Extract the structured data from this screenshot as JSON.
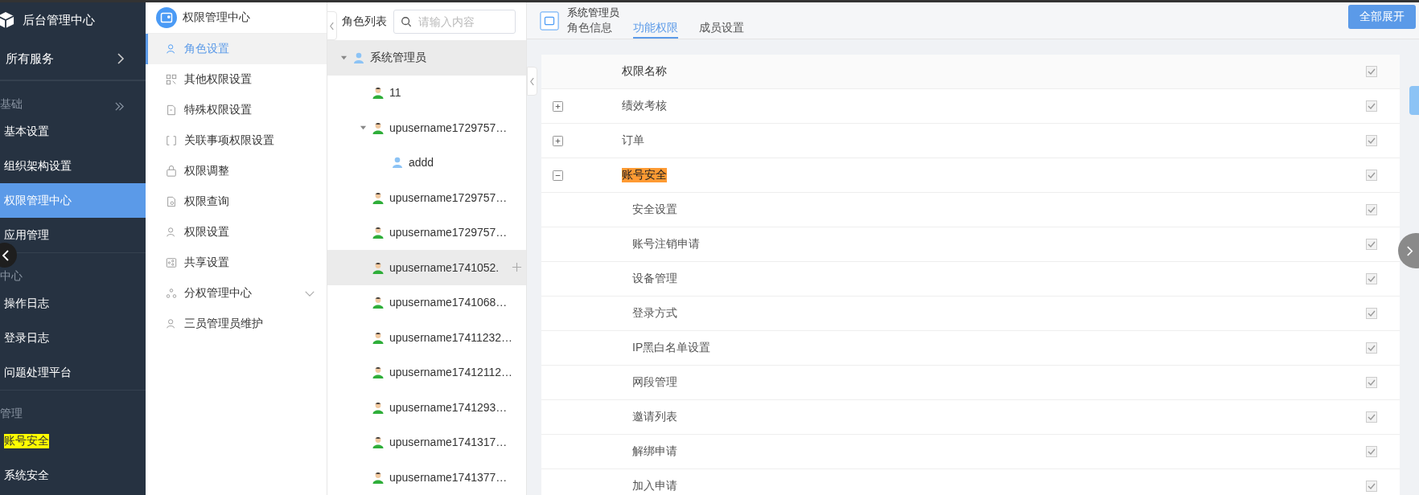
{
  "app": {
    "title": "后台管理中心"
  },
  "left_nav": [
    {
      "kind": "service",
      "label": "所有服务"
    },
    {
      "kind": "section",
      "label": "基础"
    },
    {
      "kind": "item",
      "label": "基本设置",
      "selected": false,
      "highlighted": false
    },
    {
      "kind": "item",
      "label": "组织架构设置",
      "selected": false,
      "highlighted": false
    },
    {
      "kind": "item",
      "label": "权限管理中心",
      "selected": true,
      "highlighted": false
    },
    {
      "kind": "item",
      "label": "应用管理",
      "selected": false,
      "highlighted": false
    },
    {
      "kind": "section",
      "label": "中心"
    },
    {
      "kind": "item",
      "label": "操作日志",
      "selected": false,
      "highlighted": false
    },
    {
      "kind": "item",
      "label": "登录日志",
      "selected": false,
      "highlighted": false
    },
    {
      "kind": "item",
      "label": "问题处理平台",
      "selected": false,
      "highlighted": false
    },
    {
      "kind": "section",
      "label": "管理"
    },
    {
      "kind": "item",
      "label": "账号安全",
      "selected": false,
      "highlighted": true
    },
    {
      "kind": "item",
      "label": "系统安全",
      "selected": false,
      "highlighted": false
    }
  ],
  "sub_nav": {
    "title": "权限管理中心",
    "items": [
      {
        "label": "角色设置",
        "selected": true,
        "expandable": false
      },
      {
        "label": "其他权限设置",
        "selected": false,
        "expandable": false
      },
      {
        "label": "特殊权限设置",
        "selected": false,
        "expandable": false
      },
      {
        "label": "关联事项权限设置",
        "selected": false,
        "expandable": false
      },
      {
        "label": "权限调整",
        "selected": false,
        "expandable": false
      },
      {
        "label": "权限查询",
        "selected": false,
        "expandable": false
      },
      {
        "label": "权限设置",
        "selected": false,
        "expandable": false
      },
      {
        "label": "共享设置",
        "selected": false,
        "expandable": false
      },
      {
        "label": "分权管理中心",
        "selected": false,
        "expandable": true
      },
      {
        "label": "三员管理员维护",
        "selected": false,
        "expandable": false
      }
    ]
  },
  "role_list": {
    "title": "角色列表",
    "search_placeholder": "请输入内容",
    "nodes": [
      {
        "kind": "role",
        "label": "系统管理员",
        "expanded": true,
        "selected": true,
        "hovered": false,
        "children": [
          {
            "kind": "user",
            "label": "11",
            "selected": false,
            "hovered": false
          },
          {
            "kind": "user",
            "label": "upusername1729757…",
            "expanded": true,
            "selected": false,
            "hovered": false,
            "children": [
              {
                "kind": "role",
                "label": "addd",
                "selected": false,
                "hovered": false
              }
            ]
          },
          {
            "kind": "user",
            "label": "upusername1729757…",
            "selected": false,
            "hovered": false
          },
          {
            "kind": "user",
            "label": "upusername1729757…",
            "selected": false,
            "hovered": false
          },
          {
            "kind": "user",
            "label": "upusername1741052.",
            "selected": false,
            "hovered": true
          },
          {
            "kind": "user",
            "label": "upusername1741068…",
            "selected": false,
            "hovered": false
          },
          {
            "kind": "user",
            "label": "upusername17411232…",
            "selected": false,
            "hovered": false
          },
          {
            "kind": "user",
            "label": "upusername17412112…",
            "selected": false,
            "hovered": false
          },
          {
            "kind": "user",
            "label": "upusername1741293…",
            "selected": false,
            "hovered": false
          },
          {
            "kind": "user",
            "label": "upusername1741317…",
            "selected": false,
            "hovered": false
          },
          {
            "kind": "user",
            "label": "upusername1741377…",
            "selected": false,
            "hovered": false
          }
        ]
      }
    ]
  },
  "role_header": {
    "title": "系统管理员",
    "tabs": [
      {
        "label": "角色信息",
        "selected": false
      },
      {
        "label": "功能权限",
        "selected": true
      },
      {
        "label": "成员设置",
        "selected": false
      }
    ]
  },
  "expand_all_button": "全部展开",
  "permissions": {
    "column": "权限名称",
    "all_checked": true,
    "rows": [
      {
        "label": "绩效考核",
        "expanded": false,
        "highlighted": false,
        "checked": true
      },
      {
        "label": "订单",
        "expanded": false,
        "highlighted": false,
        "checked": true
      },
      {
        "label": "账号安全",
        "expanded": true,
        "highlighted": true,
        "checked": true,
        "children": [
          {
            "label": "安全设置",
            "checked": true
          },
          {
            "label": "账号注销申请",
            "checked": true
          },
          {
            "label": "设备管理",
            "checked": true
          },
          {
            "label": "登录方式",
            "checked": true
          },
          {
            "label": "IP黑白名单设置",
            "checked": true
          },
          {
            "label": "网段管理",
            "checked": true
          },
          {
            "label": "邀请列表",
            "checked": true
          },
          {
            "label": "解绑申请",
            "checked": true
          },
          {
            "label": "加入申请",
            "checked": true
          }
        ]
      }
    ]
  }
}
